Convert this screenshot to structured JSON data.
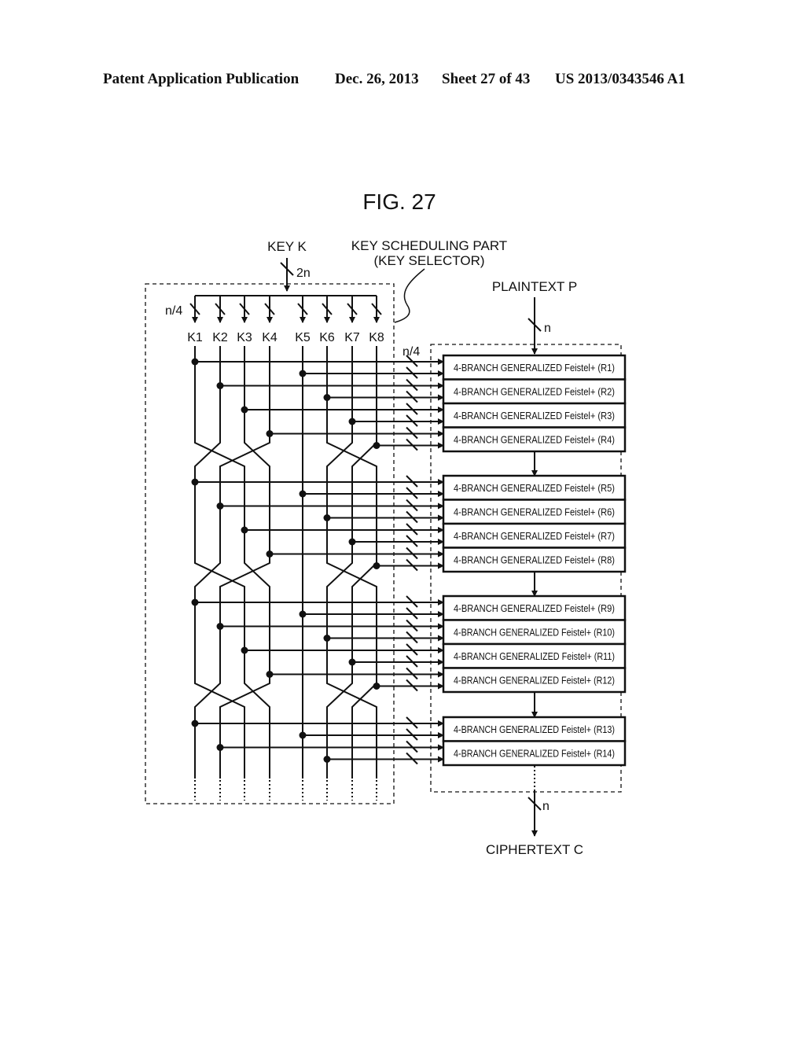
{
  "header": {
    "publication": "Patent Application Publication",
    "date": "Dec. 26, 2013",
    "sheet": "Sheet 27 of 43",
    "number": "US 2013/0343546 A1"
  },
  "figure": {
    "title": "FIG. 27",
    "key_input": "KEY K",
    "key_width": "2n",
    "key_part_label_1": "KEY SCHEDULING PART",
    "key_part_label_2": "(KEY SELECTOR)",
    "subkey_width": "n/4",
    "subkeys": [
      "K1",
      "K2",
      "K3",
      "K4",
      "K5",
      "K6",
      "K7",
      "K8"
    ],
    "plaintext": "PLAINTEXT P",
    "plaintext_width": "n",
    "bus_width": "n/4",
    "ciphertext": "CIPHERTEXT C",
    "ciphertext_width": "n",
    "rounds": [
      "4-BRANCH GENERALIZED Feistel+ (R1)",
      "4-BRANCH GENERALIZED Feistel+ (R2)",
      "4-BRANCH GENERALIZED Feistel+ (R3)",
      "4-BRANCH GENERALIZED Feistel+ (R4)",
      "4-BRANCH GENERALIZED Feistel+ (R5)",
      "4-BRANCH GENERALIZED Feistel+ (R6)",
      "4-BRANCH GENERALIZED Feistel+ (R7)",
      "4-BRANCH GENERALIZED Feistel+ (R8)",
      "4-BRANCH GENERALIZED Feistel+ (R9)",
      "4-BRANCH GENERALIZED Feistel+ (R10)",
      "4-BRANCH GENERALIZED Feistel+ (R11)",
      "4-BRANCH GENERALIZED Feistel+ (R12)",
      "4-BRANCH GENERALIZED Feistel+ (R13)",
      "4-BRANCH GENERALIZED Feistel+ (R14)"
    ]
  }
}
